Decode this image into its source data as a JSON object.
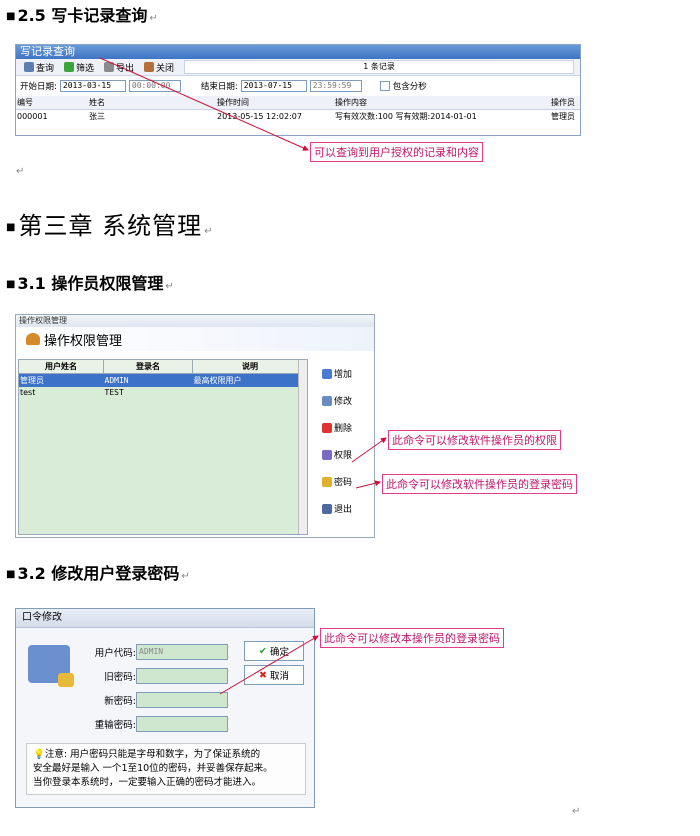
{
  "section_2_5": {
    "heading": "2.5 写卡记录查询"
  },
  "screen1": {
    "title": "写记录查询",
    "toolbar": [
      "查询",
      "筛选",
      "导出",
      "关闭"
    ],
    "record_count": "1 条记录",
    "start_label": "开始日期:",
    "start_date": "2013-03-15",
    "start_time": "00:00:00",
    "end_label": "结束日期:",
    "end_date": "2013-07-15",
    "end_time": "23:59:59",
    "include_seconds": "包含分秒",
    "columns": [
      "编号",
      "姓名",
      "操作时间",
      "操作内容",
      "操作员"
    ],
    "rows": [
      [
        "000001",
        "张三",
        "2013-05-15 12:02:07",
        "写有效次数:100 写有效期:2014-01-01",
        "管理员"
      ]
    ],
    "callout": "可以查询到用户授权的记录和内容"
  },
  "chapter3": {
    "heading": "第三章 系统管理"
  },
  "section_3_1": {
    "heading": "3.1 操作员权限管理"
  },
  "screen2": {
    "window_title": "操作权限管理",
    "header": "操作权限管理",
    "columns": [
      "用户姓名",
      "登录名",
      "说明"
    ],
    "rows": [
      [
        "管理员",
        "ADMIN",
        "最高权限用户"
      ],
      [
        "test",
        "TEST",
        ""
      ]
    ],
    "buttons": [
      "增加",
      "修改",
      "删除",
      "权限",
      "密码",
      "退出"
    ],
    "callout_permission": "此命令可以修改软件操作员的权限",
    "callout_password": "此命令可以修改软件操作员的登录密码"
  },
  "section_3_2": {
    "heading": "3.2 修改用户登录密码"
  },
  "screen3": {
    "window_title": "口令修改",
    "user_code_label": "用户代码:",
    "user_code_value": "ADMIN",
    "old_pw_label": "旧密码:",
    "new_pw_label": "新密码:",
    "confirm_pw_label": "重输密码:",
    "ok_label": "确定",
    "cancel_label": "取消",
    "note_line1": "注意: 用户密码只能是字母和数字，为了保证系统的",
    "note_line2": "安全最好是输入 一个1至10位的密码，并妥善保存起来。",
    "note_line3": "当你登录本系统时，一定要输入正确的密码才能进入。",
    "callout": "此命令可以修改本操作员的登录密码"
  },
  "colors": {
    "accent": "#e33c8c",
    "title_blue": "#3d74c4",
    "grid_green": "#d8ecd8"
  }
}
